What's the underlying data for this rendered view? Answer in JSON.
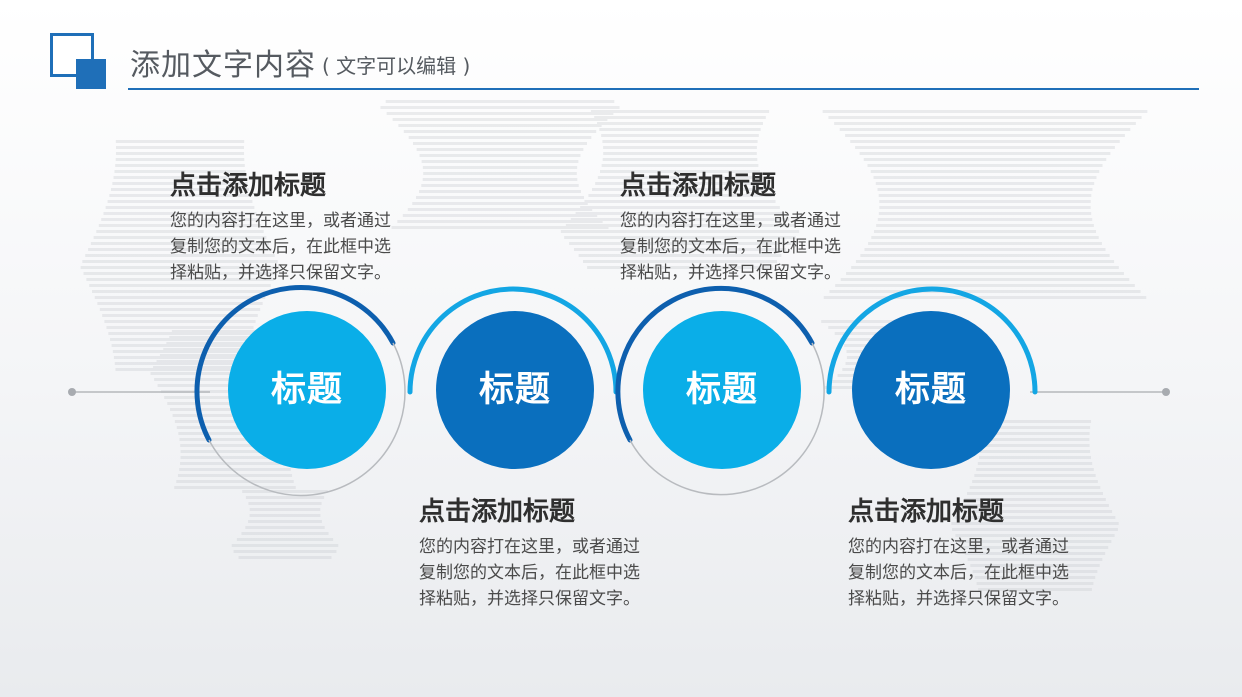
{
  "header": {
    "title": "添加文字内容",
    "subtitle": "( 文字可以编辑 )"
  },
  "colors": {
    "accent": "#1f6fb8",
    "circle_light": "#0aaee8",
    "circle_dark": "#0a6fbe",
    "arc_light": "#13a6e4",
    "arc_dark": "#0d5fae"
  },
  "steps": [
    {
      "circle_label": "标题",
      "title": "点击添加标题",
      "lines": [
        "您的内容打在这里，或者通过",
        "复制您的文本后，在此框中选",
        "择粘贴，并选择只保留文字。"
      ]
    },
    {
      "circle_label": "标题",
      "title": "点击添加标题",
      "lines": [
        "您的内容打在这里，或者通过",
        "复制您的文本后，在此框中选",
        "择粘贴，并选择只保留文字。"
      ]
    },
    {
      "circle_label": "标题",
      "title": "点击添加标题",
      "lines": [
        "您的内容打在这里，或者通过",
        "复制您的文本后，在此框中选",
        "择粘贴，并选择只保留文字。"
      ]
    },
    {
      "circle_label": "标题",
      "title": "点击添加标题",
      "lines": [
        "您的内容打在这里，或者通过",
        "复制您的文本后，在此框中选",
        "择粘贴，并选择只保留文字。"
      ]
    }
  ]
}
